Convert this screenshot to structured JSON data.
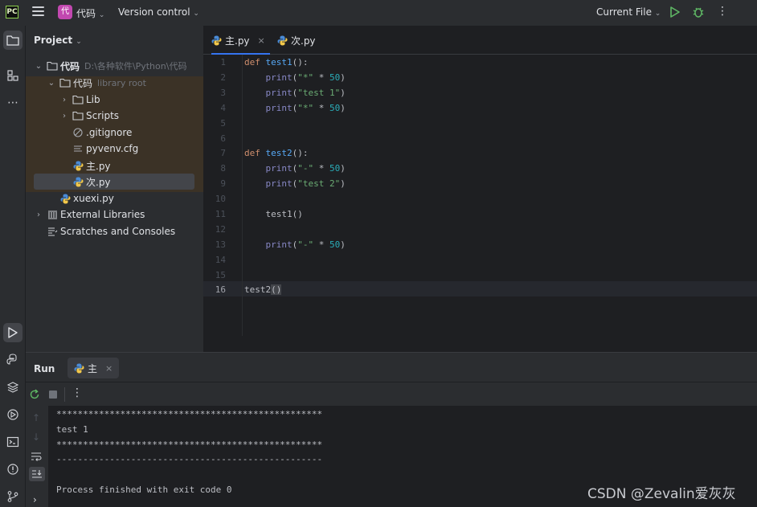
{
  "topbar": {
    "logo_text": "PC",
    "project_badge": "代",
    "project_name": "代码",
    "version_control": "Version control",
    "run_config": "Current File"
  },
  "project_panel": {
    "title": "Project",
    "tree": [
      {
        "label": "代码",
        "hint": "D:\\各种软件\\Python\\代码",
        "icon": "folder-icon",
        "expanded": true
      },
      {
        "label": "代码",
        "hint": "library root",
        "icon": "folder-icon",
        "expanded": true
      },
      {
        "label": "Lib",
        "hint": "",
        "icon": "folder-icon",
        "expanded": false
      },
      {
        "label": "Scripts",
        "hint": "",
        "icon": "folder-icon",
        "expanded": false
      },
      {
        "label": ".gitignore",
        "hint": "",
        "icon": "ignore-file-icon"
      },
      {
        "label": "pyvenv.cfg",
        "hint": "",
        "icon": "text-file-icon"
      },
      {
        "label": "主.py",
        "hint": "",
        "icon": "python-file-icon"
      },
      {
        "label": "次.py",
        "hint": "",
        "icon": "python-file-icon",
        "selected": true
      },
      {
        "label": "xuexi.py",
        "hint": "",
        "icon": "python-file-icon"
      },
      {
        "label": "External Libraries",
        "hint": "",
        "icon": "library-icon",
        "expanded": false
      },
      {
        "label": "Scratches and Consoles",
        "hint": "",
        "icon": "scratches-icon"
      }
    ]
  },
  "editor": {
    "tabs": [
      {
        "label": "主.py",
        "active": true,
        "close": "×"
      },
      {
        "label": "次.py",
        "active": false
      }
    ],
    "line_numbers": [
      "1",
      "2",
      "3",
      "4",
      "5",
      "6",
      "7",
      "8",
      "9",
      "10",
      "11",
      "12",
      "13",
      "14",
      "15",
      "16"
    ],
    "current_line": "16"
  },
  "run_panel": {
    "title": "Run",
    "tab_label": "主",
    "tab_close": "×",
    "output": [
      "**************************************************",
      "test 1",
      "**************************************************",
      "--------------------------------------------------",
      "",
      "Process finished with exit code 0"
    ]
  },
  "watermark": "CSDN @Zevalin爱灰灰",
  "colors": {
    "accent": "#3574f0",
    "keyword": "#cf8e6d",
    "function": "#56a8f5",
    "string": "#6aab73",
    "number": "#2aacb8",
    "run_green": "#5fb865"
  }
}
